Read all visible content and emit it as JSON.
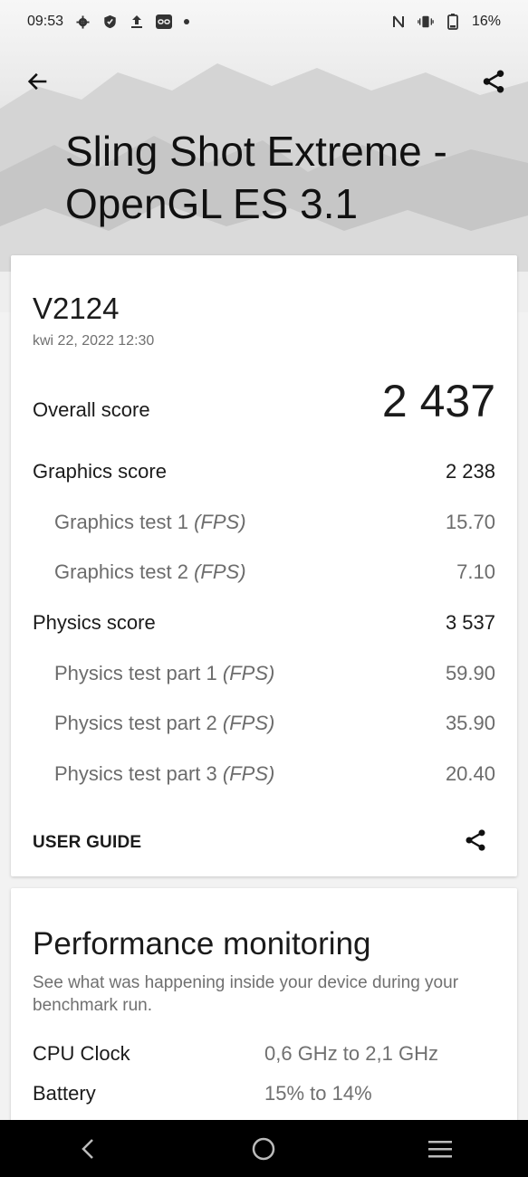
{
  "status_bar": {
    "time": "09:53",
    "left_icons": [
      "settings-icon",
      "shield-icon",
      "upload-icon",
      "link-icon",
      "dot-icon"
    ],
    "right_icons": [
      "nfc-icon",
      "vibrate-icon",
      "battery-icon"
    ],
    "battery": "16%"
  },
  "header": {
    "title": "Sling Shot Extreme - OpenGL ES 3.1"
  },
  "results": {
    "device": "V2124",
    "date": "kwi 22, 2022 12:30",
    "overall_label": "Overall score",
    "overall_value": "2 437",
    "graphics_label": "Graphics score",
    "graphics_value": "2 238",
    "graphics_tests": [
      {
        "label": "Graphics test 1",
        "unit": "(FPS)",
        "value": "15.70"
      },
      {
        "label": "Graphics test 2",
        "unit": "(FPS)",
        "value": "7.10"
      }
    ],
    "physics_label": "Physics score",
    "physics_value": "3 537",
    "physics_tests": [
      {
        "label": "Physics test part 1",
        "unit": "(FPS)",
        "value": "59.90"
      },
      {
        "label": "Physics test part 2",
        "unit": "(FPS)",
        "value": "35.90"
      },
      {
        "label": "Physics test part 3",
        "unit": "(FPS)",
        "value": "20.40"
      }
    ],
    "user_guide": "USER GUIDE"
  },
  "performance": {
    "title": "Performance monitoring",
    "description": "See what was happening inside your device during your benchmark run.",
    "rows": [
      {
        "key": "CPU Clock",
        "value": "0,6 GHz to 2,1 GHz"
      },
      {
        "key": "Battery",
        "value": "15% to 14%"
      }
    ]
  },
  "colors": {
    "accent": "#f08324",
    "nav_bg": "#000000",
    "card_bg": "#ffffff",
    "page_bg": "#f2f2f2"
  }
}
